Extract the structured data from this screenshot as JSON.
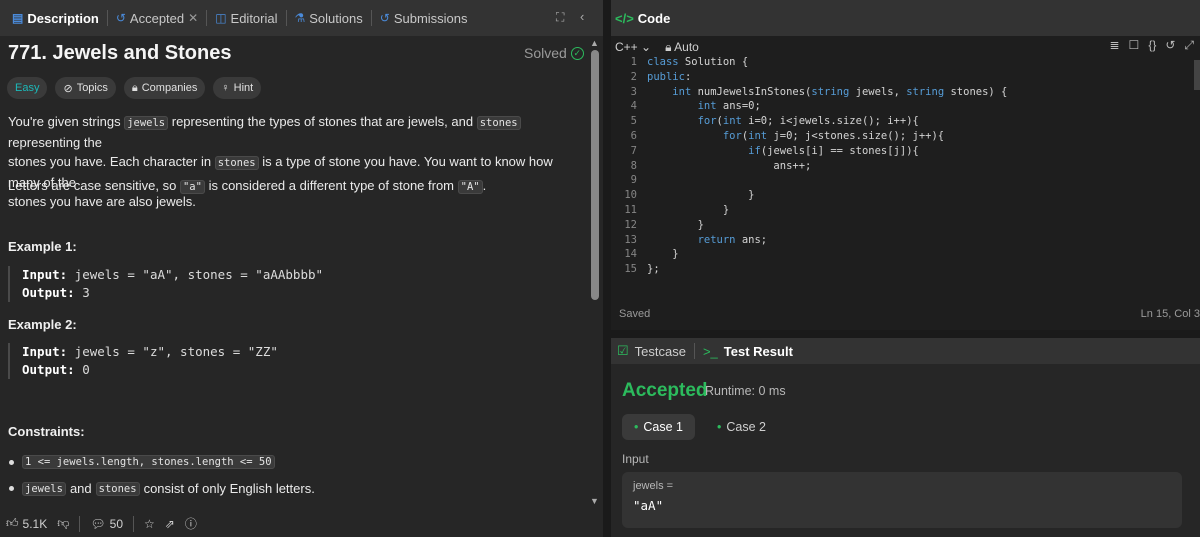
{
  "left_tabs": [
    {
      "label": "Description",
      "icon": "description-icon"
    },
    {
      "label": "Accepted",
      "icon": "history-icon"
    },
    {
      "label": "Editorial",
      "icon": "book-icon"
    },
    {
      "label": "Solutions",
      "icon": "flask-icon"
    },
    {
      "label": "Submissions",
      "icon": "history-icon"
    }
  ],
  "problem": {
    "title": "771. Jewels and Stones",
    "status": "Solved",
    "tags": [
      "Easy",
      "Topics",
      "Companies",
      "Hint"
    ],
    "para1_a": "You're given strings ",
    "para1_code1": "jewels",
    "para1_b": " representing the types of stones that are jewels, and ",
    "para1_code2": "stones",
    "para1_c": " representing the",
    "para1_d": "stones you have. Each character in ",
    "para1_code3": "stones",
    "para1_e": " is a type of stone you have. You want to know how many of the",
    "para1_f": "stones you have are also jewels.",
    "para2_a": "Letters are case sensitive, so ",
    "para2_code1": "\"a\"",
    "para2_b": " is considered a different type of stone from ",
    "para2_code2": "\"A\"",
    "para2_c": ".",
    "example1": {
      "heading": "Example 1:",
      "input_label": "Input:",
      "input": " jewels = \"aA\", stones = \"aAAbbbb\"",
      "output_label": "Output:",
      "output": " 3"
    },
    "example2": {
      "heading": "Example 2:",
      "input_label": "Input:",
      "input": " jewels = \"z\", stones = \"ZZ\"",
      "output_label": "Output:",
      "output": " 0"
    },
    "constraints_heading": "Constraints:",
    "constraint1": "1 <= jewels.length, stones.length <= 50",
    "constraint2_code1": "jewels",
    "constraint2_mid": " and ",
    "constraint2_code2": "stones",
    "constraint2_end": " consist of only English letters."
  },
  "footer": {
    "likes": "5.1K",
    "comments": "50"
  },
  "code": {
    "header": "Code",
    "header_icon": "</>",
    "language": "C++",
    "mode": "Auto",
    "lines": [
      {
        "n": "1",
        "t": "class Solution {"
      },
      {
        "n": "2",
        "t": "public:"
      },
      {
        "n": "3",
        "t": "    int numJewelsInStones(string jewels, string stones) {"
      },
      {
        "n": "4",
        "t": "        int ans=0;"
      },
      {
        "n": "5",
        "t": "        for(int i=0; i<jewels.size(); i++){"
      },
      {
        "n": "6",
        "t": "            for(int j=0; j<stones.size(); j++){"
      },
      {
        "n": "7",
        "t": "                if(jewels[i] == stones[j]){"
      },
      {
        "n": "8",
        "t": "                    ans++;"
      },
      {
        "n": "9",
        "t": ""
      },
      {
        "n": "10",
        "t": "                }"
      },
      {
        "n": "11",
        "t": "            }"
      },
      {
        "n": "12",
        "t": "        }"
      },
      {
        "n": "13",
        "t": "        return ans;"
      },
      {
        "n": "14",
        "t": "    }"
      },
      {
        "n": "15",
        "t": "};"
      }
    ],
    "saved": "Saved",
    "cursor": "Ln 15, Col 3"
  },
  "test": {
    "tab_testcase": "Testcase",
    "tab_result": "Test Result",
    "status": "Accepted",
    "runtime": "Runtime: 0 ms",
    "case1": "Case 1",
    "case2": "Case 2",
    "input_label": "Input",
    "var_name": "jewels =",
    "var_value": "\"aA\""
  }
}
